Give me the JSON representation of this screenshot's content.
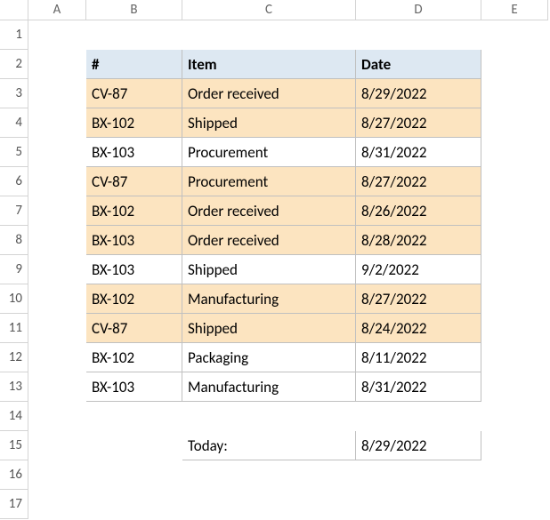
{
  "columns": [
    "A",
    "B",
    "C",
    "D",
    "E"
  ],
  "rowCount": 17,
  "header": {
    "num": "#",
    "item": "Item",
    "date": "Date"
  },
  "rows": [
    {
      "num": "CV-87",
      "item": "Order received",
      "date": "8/29/2022",
      "hl": true
    },
    {
      "num": "BX-102",
      "item": "Shipped",
      "date": "8/27/2022",
      "hl": true
    },
    {
      "num": "BX-103",
      "item": "Procurement",
      "date": "8/31/2022",
      "hl": false
    },
    {
      "num": "CV-87",
      "item": "Procurement",
      "date": "8/27/2022",
      "hl": true
    },
    {
      "num": "BX-102",
      "item": "Order received",
      "date": "8/26/2022",
      "hl": true
    },
    {
      "num": "BX-103",
      "item": "Order received",
      "date": "8/28/2022",
      "hl": true
    },
    {
      "num": "BX-103",
      "item": "Shipped",
      "date": "9/2/2022",
      "hl": false
    },
    {
      "num": "BX-102",
      "item": "Manufacturing",
      "date": "8/27/2022",
      "hl": true
    },
    {
      "num": "CV-87",
      "item": "Shipped",
      "date": "8/24/2022",
      "hl": true
    },
    {
      "num": "BX-102",
      "item": "Packaging",
      "date": "8/11/2022",
      "hl": false
    },
    {
      "num": "BX-103",
      "item": "Manufacturing",
      "date": "8/31/2022",
      "hl": false
    }
  ],
  "today": {
    "label": "Today:",
    "value": "8/29/2022"
  }
}
